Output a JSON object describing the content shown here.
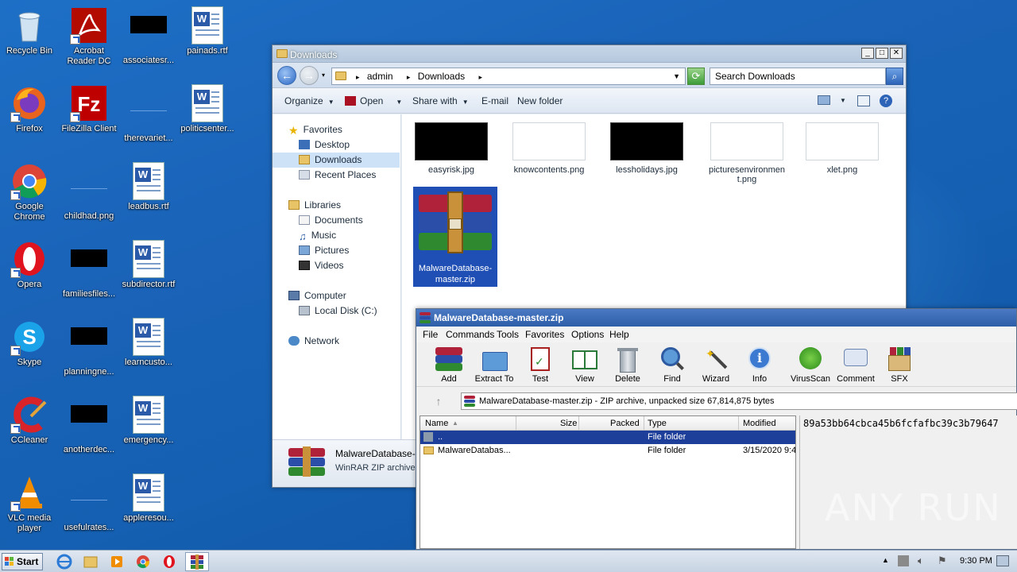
{
  "desktop": {
    "icons": [
      {
        "label": "Recycle Bin"
      },
      {
        "label": "Acrobat Reader DC"
      },
      {
        "label": "associatesr..."
      },
      {
        "label": "painads.rtf"
      },
      {
        "label": "Firefox"
      },
      {
        "label": "FileZilla Client"
      },
      {
        "label": "therevariet..."
      },
      {
        "label": "politicsenter..."
      },
      {
        "label": "Google Chrome"
      },
      {
        "label": "childhad.png"
      },
      {
        "label": "leadbus.rtf"
      },
      {
        "label": "Opera"
      },
      {
        "label": "familiesfiles..."
      },
      {
        "label": "subdirector.rtf"
      },
      {
        "label": "Skype"
      },
      {
        "label": "planningne..."
      },
      {
        "label": "learncusto..."
      },
      {
        "label": "CCleaner"
      },
      {
        "label": "anotherdec..."
      },
      {
        "label": "emergency..."
      },
      {
        "label": "VLC media player"
      },
      {
        "label": "usefulrates..."
      },
      {
        "label": "appleresou..."
      }
    ]
  },
  "explorer": {
    "title": "Downloads",
    "address": [
      "admin",
      "Downloads"
    ],
    "search_placeholder": "Search Downloads",
    "commands": {
      "organize": "Organize",
      "open": "Open",
      "share": "Share with",
      "email": "E-mail",
      "newfolder": "New folder"
    },
    "nav": {
      "favorites": "Favorites",
      "desktop": "Desktop",
      "downloads": "Downloads",
      "recent": "Recent Places",
      "libraries": "Libraries",
      "documents": "Documents",
      "music": "Music",
      "pictures": "Pictures",
      "videos": "Videos",
      "computer": "Computer",
      "localdisk": "Local Disk (C:)",
      "network": "Network"
    },
    "files": [
      {
        "name": "easyrisk.jpg"
      },
      {
        "name": "knowcontents.png"
      },
      {
        "name": "lessholidays.jpg"
      },
      {
        "name": "picturesenvironment.png"
      },
      {
        "name": "xlet.png"
      },
      {
        "name": "MalwareDatabase-master.zip"
      }
    ],
    "details": {
      "name": "MalwareDatabase-m",
      "type": "WinRAR ZIP archive"
    }
  },
  "winrar": {
    "title": "MalwareDatabase-master.zip",
    "menu": [
      "File",
      "Commands",
      "Tools",
      "Favorites",
      "Options",
      "Help"
    ],
    "tools": [
      "Add",
      "Extract To",
      "Test",
      "View",
      "Delete",
      "Find",
      "Wizard",
      "Info",
      "VirusScan",
      "Comment",
      "SFX"
    ],
    "path": "MalwareDatabase-master.zip - ZIP archive, unpacked size 67,814,875 bytes",
    "columns": {
      "name": "Name",
      "size": "Size",
      "packed": "Packed",
      "type": "Type",
      "modified": "Modified"
    },
    "rows": [
      {
        "name": "..",
        "type": "File folder",
        "modified": ""
      },
      {
        "name": "MalwareDatabas...",
        "type": "File folder",
        "modified": "3/15/2020 9:4"
      }
    ],
    "comment": "89a53bb64cbca45b6fcfafbc39c3b79647"
  },
  "taskbar": {
    "start": "Start",
    "clock": "9:30 PM"
  },
  "watermark": "ANY RUN"
}
